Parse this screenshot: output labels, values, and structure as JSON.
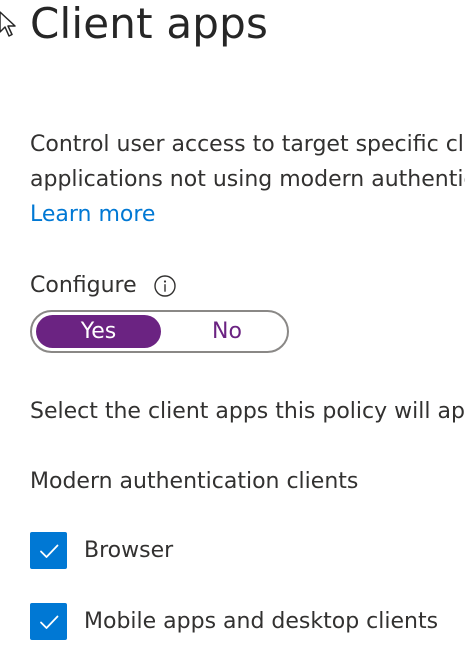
{
  "page": {
    "title": "Client apps"
  },
  "description": {
    "line1": "Control user access to target specific client",
    "line2": "applications not using modern authentication.",
    "learn_more": "Learn more"
  },
  "configure": {
    "label": "Configure",
    "info_icon": "info-icon",
    "options": {
      "yes": "Yes",
      "no": "No"
    },
    "selected": "Yes"
  },
  "select_text": "Select the client apps this policy will apply to",
  "modern_auth": {
    "heading": "Modern authentication clients",
    "items": [
      {
        "label": "Browser",
        "checked": true
      },
      {
        "label": "Mobile apps and desktop clients",
        "checked": true
      }
    ]
  },
  "colors": {
    "accent_purple": "#6b2382",
    "checkbox_blue": "#0078d4",
    "link_blue": "#0078d4",
    "text": "#323130"
  }
}
